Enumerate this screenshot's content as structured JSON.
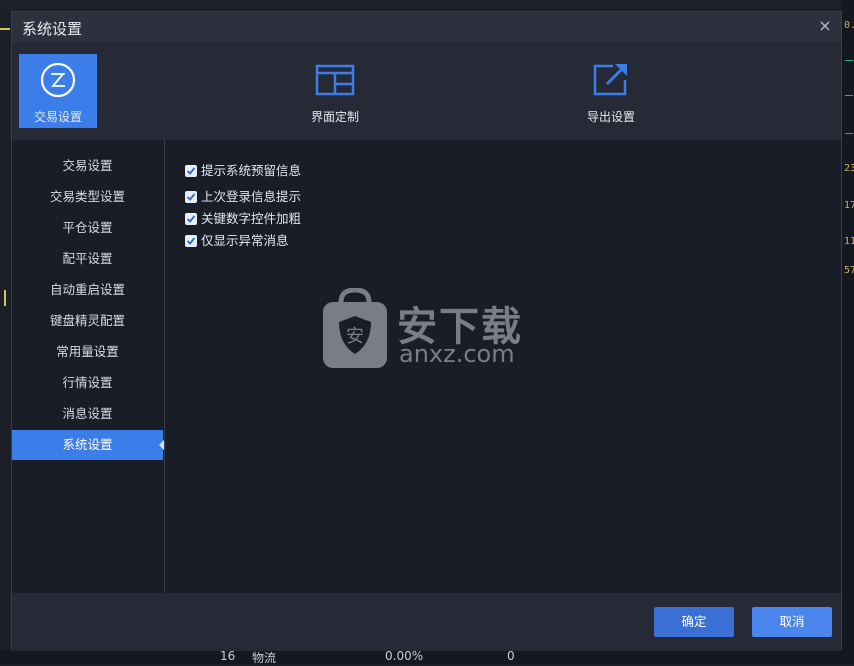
{
  "window": {
    "title": "系统设置",
    "close_glyph": "×"
  },
  "top_tabs": [
    {
      "label": "交易设置",
      "icon": "trade-settings-icon",
      "active": true
    },
    {
      "label": "界面定制",
      "icon": "layout-icon",
      "active": false
    },
    {
      "label": "导出设置",
      "icon": "export-icon",
      "active": false
    }
  ],
  "sidebar": {
    "items": [
      {
        "label": "交易设置"
      },
      {
        "label": "交易类型设置"
      },
      {
        "label": "平仓设置"
      },
      {
        "label": "配平设置"
      },
      {
        "label": "自动重启设置"
      },
      {
        "label": "键盘精灵配置"
      },
      {
        "label": "常用量设置"
      },
      {
        "label": "行情设置"
      },
      {
        "label": "消息设置"
      },
      {
        "label": "系统设置",
        "active": true
      }
    ]
  },
  "options": [
    {
      "label": "提示系统预留信息",
      "checked": true
    },
    {
      "label": "上次登录信息提示",
      "checked": true
    },
    {
      "label": "关键数字控件加粗",
      "checked": true
    },
    {
      "label": "仅显示异常消息",
      "checked": true
    }
  ],
  "watermark": {
    "text": "安下载",
    "sub": "anxz.com",
    "badge": "安"
  },
  "footer": {
    "ok_label": "确定",
    "cancel_label": "取消"
  },
  "background": {
    "right_numbers": [
      "0.",
      "23",
      "17",
      "11",
      "57"
    ],
    "bottom_row": [
      "16",
      "物流",
      "0.00%",
      "0"
    ]
  },
  "colors": {
    "accent": "#3b7de9",
    "panel": "#191d28",
    "dialog": "#262a36"
  }
}
